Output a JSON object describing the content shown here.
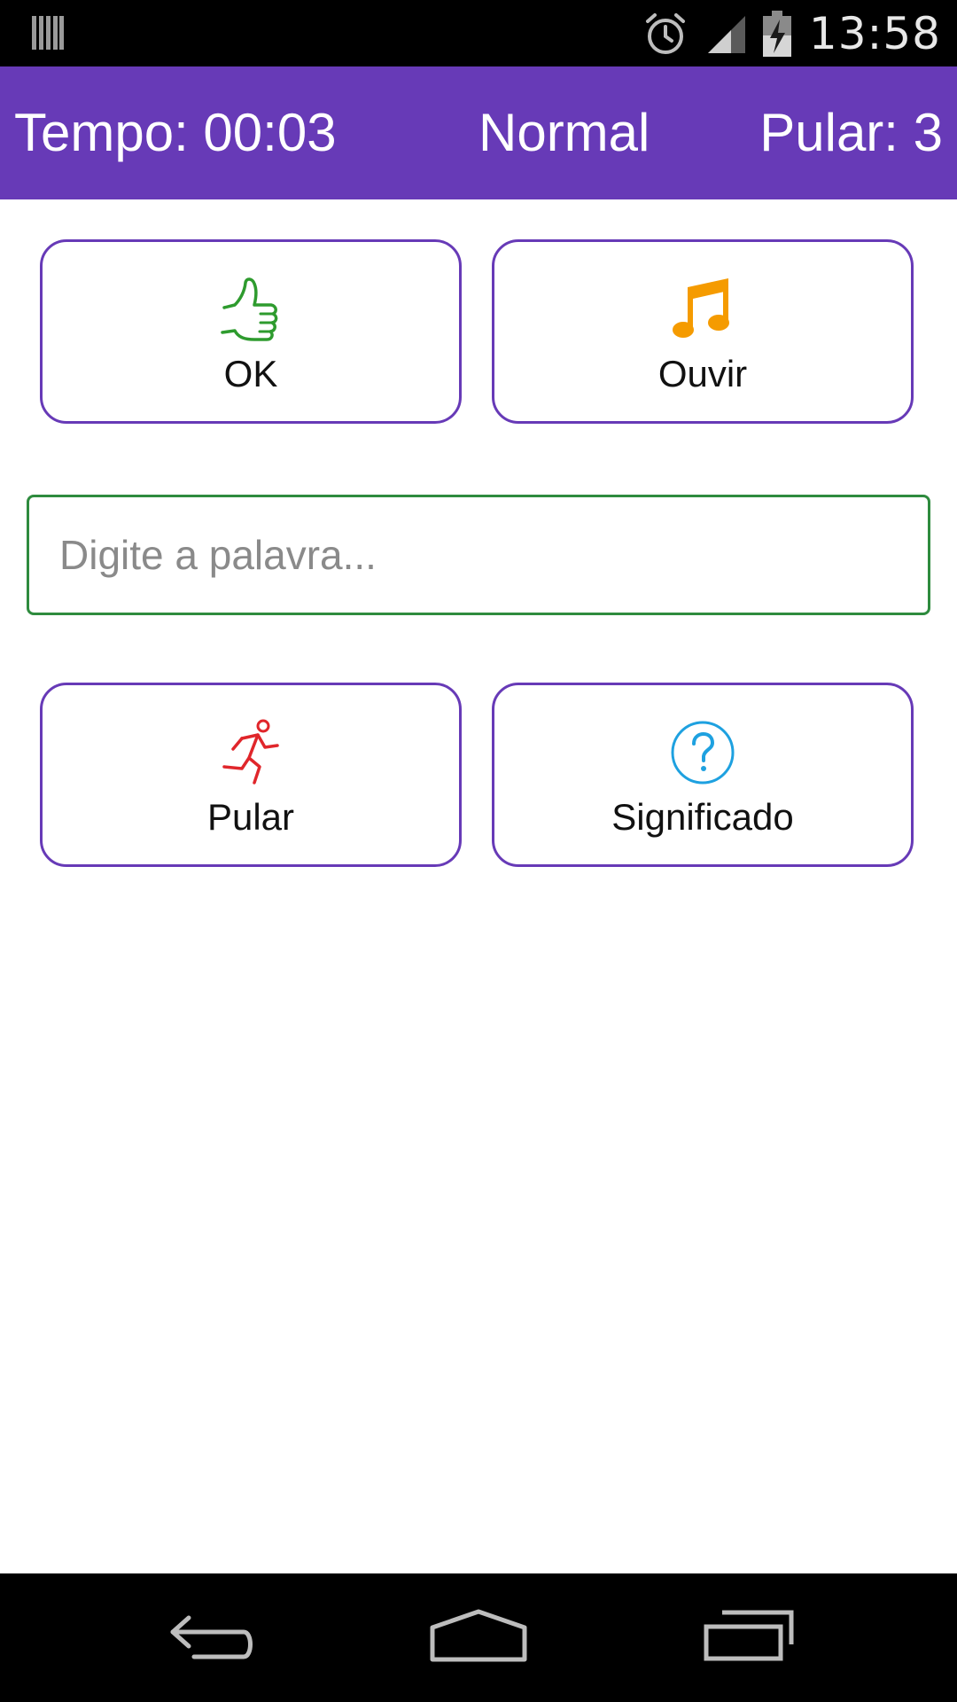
{
  "status_bar": {
    "time": "13:58",
    "icons": [
      "barcode-icon",
      "alarm-icon",
      "signal-icon",
      "battery-charging-icon"
    ]
  },
  "header": {
    "time_label": "Tempo: 00:03",
    "mode_label": "Normal",
    "skips_label": "Pular: 3",
    "background_color": "#673ab7"
  },
  "actions": {
    "ok": {
      "label": "OK",
      "icon": "thumbs-up-icon",
      "color": "#2e9b2e"
    },
    "listen": {
      "label": "Ouvir",
      "icon": "music-note-icon",
      "color": "#f59b00"
    },
    "skip": {
      "label": "Pular",
      "icon": "running-man-icon",
      "color": "#e0262b"
    },
    "meaning": {
      "label": "Significado",
      "icon": "question-icon",
      "color": "#1ea1e0"
    }
  },
  "word_input": {
    "value": "",
    "placeholder": "Digite a palavra..."
  },
  "nav_bar": {
    "buttons": [
      "back-icon",
      "home-icon",
      "recents-icon"
    ]
  }
}
